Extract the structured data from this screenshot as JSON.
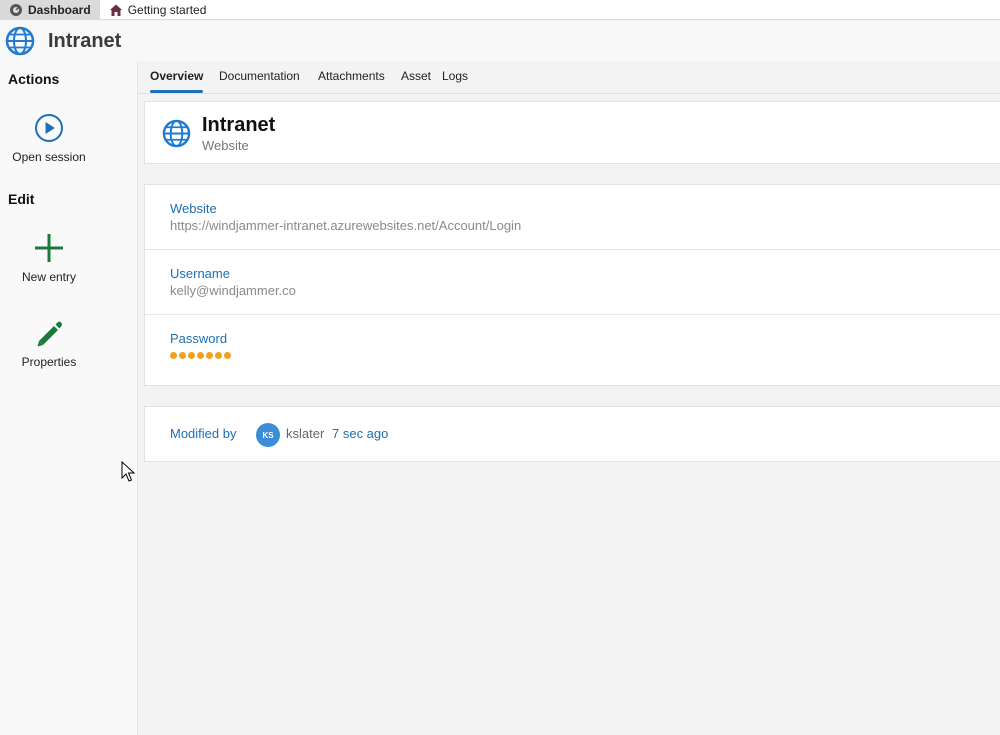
{
  "doc_tabs": [
    {
      "label": "Dashboard",
      "icon": "dashboard-icon",
      "active": true
    },
    {
      "label": "Getting started",
      "icon": "home-icon",
      "active": false
    }
  ],
  "header": {
    "title": "Intranet",
    "icon": "globe-icon"
  },
  "sidebar": {
    "actions_title": "Actions",
    "open_session_label": "Open session",
    "edit_title": "Edit",
    "new_entry_label": "New entry",
    "properties_label": "Properties"
  },
  "tabs": [
    "Overview",
    "Documentation",
    "Attachments",
    "Asset",
    "Logs"
  ],
  "entry": {
    "name": "Intranet",
    "type": "Website"
  },
  "fields": {
    "website": {
      "label": "Website",
      "value": "https://windjammer-intranet.azurewebsites.net/Account/Login"
    },
    "username": {
      "label": "Username",
      "value": "kelly@windjammer.co"
    },
    "password": {
      "label": "Password",
      "masked_length": 7
    }
  },
  "modified": {
    "label": "Modified by",
    "initials": "KS",
    "user": "kslater",
    "time": "7 sec ago"
  },
  "colors": {
    "accent": "#1f6fb5",
    "add_green": "#1a7a3c",
    "password_dot": "#f0a21d",
    "avatar": "#3a8dd6"
  }
}
